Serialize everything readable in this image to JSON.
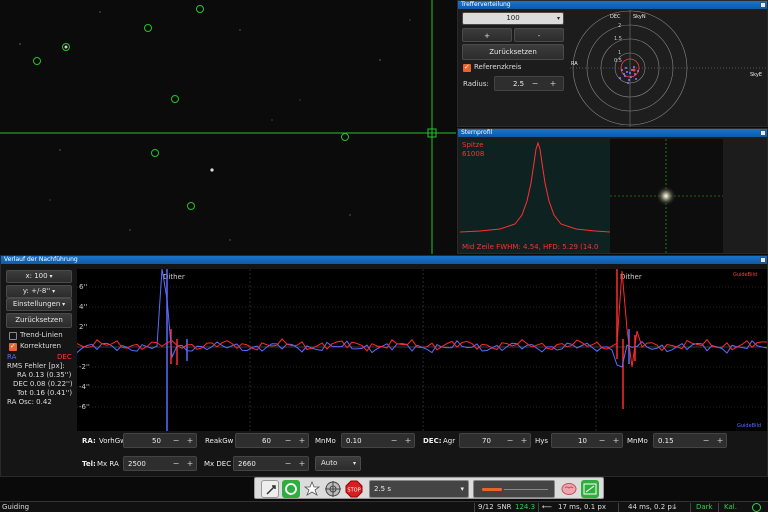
{
  "scatter": {
    "title": "Trefferverteilung",
    "dropdown_value": "100",
    "plus": "+",
    "minus": "-",
    "reset": "Zurücksetzen",
    "ref_circle_label": "Referenzkreis",
    "ref_circle_checked": true,
    "radius_label": "Radius:",
    "radius_value": "2.5",
    "axis_labels": {
      "dec": "DEC",
      "skyn": "SkyN",
      "ra": "RA",
      "skye": "SkyE"
    },
    "ring_labels": [
      "2",
      "1.5",
      "1",
      "0.5"
    ]
  },
  "profile": {
    "title": "Sternprofil",
    "peak_label": "Spitze",
    "peak_value": "61008",
    "footer": "Mid Zeile FWHM: 4.54, HFD: 5.29 (14.0"
  },
  "history": {
    "title": "Verlauf der Nachführung",
    "x_select": "x: 100",
    "y_select": "y: +/-8''",
    "settings": "Einstellungen",
    "reset": "Zurücksetzen",
    "trend_label": "Trend-Linien",
    "trend_checked": false,
    "corrections_label": "Korrekturen",
    "corrections_checked": true,
    "ra_label": "RA",
    "dec_label": "DEC",
    "rms_title": "RMS Fehler [px]:",
    "rms_ra": "RA 0.13 (0.35'')",
    "rms_dec": "DEC 0.08 (0.22'')",
    "rms_tot": "Tot 0.16 (0.41'')",
    "ra_osc": "RA Osc: 0.42",
    "dither_labels": [
      "Dither",
      "Dither"
    ],
    "y_ticks": [
      "6''",
      "4''",
      "2''",
      "-2''",
      "-4''",
      "-6''"
    ],
    "corner_top": "GuideBild",
    "corner_bottom": "GuideBild"
  },
  "params": {
    "ra_label": "RA:",
    "ra_vorhgw_label": "VorhGw",
    "ra_vorhgw": "50",
    "ra_reakgw_label": "ReakGw",
    "ra_reakgw": "60",
    "ra_mnmo_label": "MnMo",
    "ra_mnmo": "0.10",
    "dec_label": "DEC:",
    "dec_agr_label": "Agr",
    "dec_agr": "70",
    "dec_hys_label": "Hys",
    "dec_hys": "10",
    "dec_mnmo_label": "MnMo",
    "dec_mnmo": "0.15",
    "tel_label": "Tel:",
    "mxra_label": "Mx RA",
    "mxra": "2500",
    "mxdec_label": "Mx DEC",
    "mxdec": "2660",
    "auto": "Auto",
    "plus": "+",
    "minus": "−"
  },
  "toolbar": {
    "exposure": "2.5 s"
  },
  "status": {
    "mode": "Guiding",
    "frames": "9/12",
    "snr_label": "SNR",
    "snr_value": "124.3",
    "offset": "17 ms, 0.1 px",
    "offset2": "44 ms, 0.2 p:",
    "dark": "Dark",
    "kal": "Kal."
  },
  "colors": {
    "ra": "#5b6cff",
    "dec": "#ff2a2a",
    "accent": "#1b74c9",
    "crosshair": "#22c422"
  }
}
